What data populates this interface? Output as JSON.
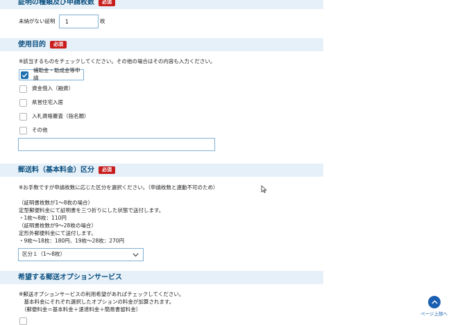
{
  "sections": {
    "type_count": {
      "title": "証明の種類及び申請枚数",
      "required": "必須"
    },
    "purpose": {
      "title": "使用目的",
      "required": "必須"
    },
    "postage": {
      "title": "郵送料（基本料金）区分",
      "required": "必須"
    },
    "options": {
      "title": "希望する郵送オプションサービス"
    }
  },
  "count": {
    "label": "未納がない証明",
    "value": "1",
    "unit": "枚"
  },
  "purpose": {
    "note": "※該当するものをチェックしてください。その他の場合はその内容も入力ください。",
    "items": [
      {
        "label": "補助金・助成金等申請",
        "checked": true
      },
      {
        "label": "資金借入（融資）",
        "checked": false
      },
      {
        "label": "県営住宅入居",
        "checked": false
      },
      {
        "label": "入札資格審査（指名願）",
        "checked": false
      },
      {
        "label": "その他",
        "checked": false
      }
    ],
    "other_value": ""
  },
  "postage": {
    "lines": [
      "※お手数ですが申請枚数に応じた区分を選択ください。（申請枚数と連動不可のため）",
      "",
      "（証明書枚数が1～8枚の場合）",
      "定型郵便料金にて証明書を三つ折りにした状態で送付します。",
      "・1枚～8枚：110円",
      "（証明書枚数が9～28枚の場合）",
      "定形外郵便料金にて送付します。",
      "・9枚～18枚：180円、19枚～28枚：270円"
    ],
    "selected": "区分１（1～8枚）"
  },
  "options": {
    "lines": [
      "※郵送オプションサービスの利用希望があればチェックしてください。",
      "　基本料金にそれぞれ選択したオプションの料金が加算されます。",
      "　（郵便料金＝基本料金＋速達料金＋簡易書留料金）"
    ]
  },
  "page_top": {
    "label": "ページ上部へ",
    "icon": "chevron-up-icon"
  },
  "colors": {
    "accent": "#1d6fb0",
    "required": "#c81e1e",
    "section_bg": "#e6f0f8",
    "section_text": "#0a4f80"
  }
}
